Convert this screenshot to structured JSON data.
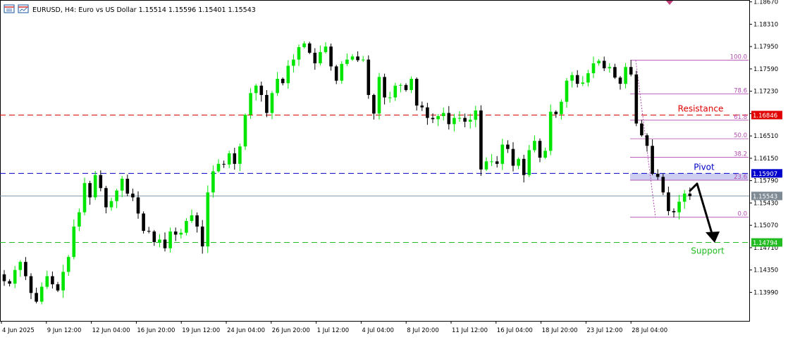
{
  "header": {
    "symbol_info": "EURUSD, H4:  Euro vs US Dollar  1.15514 1.15596 1.15401 1.15543"
  },
  "colors": {
    "bull": "#00e600",
    "bear": "#000000",
    "resistance": "#e00000",
    "pivot": "#0000cc",
    "support": "#22bb22",
    "current": "#6f8fa8",
    "fib": "#b04ab0",
    "fib_zone": "#c8c8f0",
    "arrow": "#000000"
  },
  "chart_data": {
    "type": "candlestick",
    "symbol": "EURUSD",
    "timeframe": "H4",
    "ylim": [
      1.1353,
      1.187
    ],
    "y_ticks": [
      "1.18670",
      "1.18310",
      "1.17950",
      "1.17590",
      "1.17230",
      "1.16870",
      "1.16510",
      "1.16150",
      "1.15790",
      "1.15430",
      "1.15070",
      "1.14710",
      "1.14350",
      "1.13990"
    ],
    "x_ticks": [
      "4 Jun 2025",
      "9 Jun 12:00",
      "12 Jun 04:00",
      "16 Jun 20:00",
      "19 Jun 12:00",
      "24 Jun 04:00",
      "26 Jun 20:00",
      "1 Jul 12:00",
      "4 Jul 04:00",
      "8 Jul 20:00",
      "11 Jul 12:00",
      "16 Jul 04:00",
      "18 Jul 20:00",
      "23 Jul 12:00",
      "28 Jul 04:00"
    ],
    "closes": [
      1.1417,
      1.1413,
      1.1435,
      1.1448,
      1.1425,
      1.1398,
      1.1384,
      1.1408,
      1.1425,
      1.1412,
      1.1402,
      1.1432,
      1.1456,
      1.1505,
      1.1528,
      1.1575,
      1.1552,
      1.1588,
      1.1567,
      1.1536,
      1.1546,
      1.1563,
      1.1582,
      1.1558,
      1.1552,
      1.1526,
      1.1498,
      1.1497,
      1.148,
      1.1484,
      1.147,
      1.1497,
      1.1492,
      1.1495,
      1.1514,
      1.1523,
      1.1505,
      1.1473,
      1.156,
      1.1594,
      1.1606,
      1.1605,
      1.1623,
      1.1606,
      1.1634,
      1.1685,
      1.172,
      1.1732,
      1.1717,
      1.1688,
      1.172,
      1.1743,
      1.1736,
      1.1764,
      1.1774,
      1.1794,
      1.18,
      1.1785,
      1.1768,
      1.1786,
      1.1795,
      1.1763,
      1.174,
      1.1767,
      1.1774,
      1.1779,
      1.1773,
      1.1774,
      1.1717,
      1.1687,
      1.1746,
      1.1713,
      1.1713,
      1.1732,
      1.1733,
      1.1725,
      1.1743,
      1.17,
      1.1697,
      1.168,
      1.1678,
      1.1683,
      1.1688,
      1.167,
      1.168,
      1.168,
      1.1674,
      1.1677,
      1.1692,
      1.1597,
      1.161,
      1.161,
      1.1606,
      1.1637,
      1.163,
      1.1603,
      1.1614,
      1.1588,
      1.1628,
      1.1643,
      1.1616,
      1.1627,
      1.169,
      1.1686,
      1.1706,
      1.174,
      1.1749,
      1.1735,
      1.1737,
      1.1752,
      1.1768,
      1.1772,
      1.176,
      1.1762,
      1.1745,
      1.1735,
      1.1762,
      1.175,
      1.1671,
      1.1652,
      1.1635,
      1.159,
      1.1585,
      1.156,
      1.153,
      1.1528,
      1.1545,
      1.1558,
      1.1554
    ],
    "overlays": {
      "resistance": {
        "label": "Resistance",
        "price": "1.16846"
      },
      "pivot": {
        "label": "Pivot",
        "price": "1.15907"
      },
      "support": {
        "label": "Support",
        "price": "1.14794"
      },
      "current_price": "1.15543"
    },
    "fibonacci": {
      "high": 1.1773,
      "low": 1.152,
      "levels": [
        {
          "ratio": 1.0,
          "label": "100.0"
        },
        {
          "ratio": 0.786,
          "label": "78.6"
        },
        {
          "ratio": 0.618,
          "label": "61.8"
        },
        {
          "ratio": 0.5,
          "label": "50.0"
        },
        {
          "ratio": 0.382,
          "label": "38.2"
        },
        {
          "ratio": 0.236,
          "label": "23.6"
        },
        {
          "ratio": 0.0,
          "label": "0.0"
        }
      ]
    }
  }
}
